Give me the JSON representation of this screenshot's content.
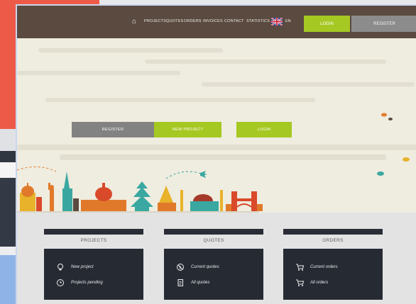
{
  "nav": {
    "items": [
      "PROJECTS",
      "QUOTES",
      "ORDERS",
      "INVOICES",
      "CONTACT",
      "STATISTICS"
    ],
    "language": "EN",
    "login_label": "LOGIN",
    "register_label": "REGISTER"
  },
  "hero": {
    "register_label": "REGISTER",
    "new_project_label": "NEW PROJECT",
    "login_label": "LOGIN"
  },
  "sections": [
    {
      "title": "PROJECTS",
      "items": [
        {
          "label": "New project",
          "icon": "lightbulb-icon"
        },
        {
          "label": "Projects pending",
          "icon": "clock-icon"
        }
      ]
    },
    {
      "title": "QUOTES",
      "items": [
        {
          "label": "Current quotes",
          "icon": "no-dollar-icon"
        },
        {
          "label": "All quotes",
          "icon": "document-icon"
        }
      ]
    },
    {
      "title": "ORDERS",
      "items": [
        {
          "label": "Current orders",
          "icon": "cart-icon"
        },
        {
          "label": "All orders",
          "icon": "cart-icon"
        }
      ]
    }
  ],
  "colors": {
    "nav_bg": "#5a4a40",
    "accent_green": "#a6c822",
    "gray_button": "#8c8c8c",
    "card_bg": "#262a33"
  }
}
